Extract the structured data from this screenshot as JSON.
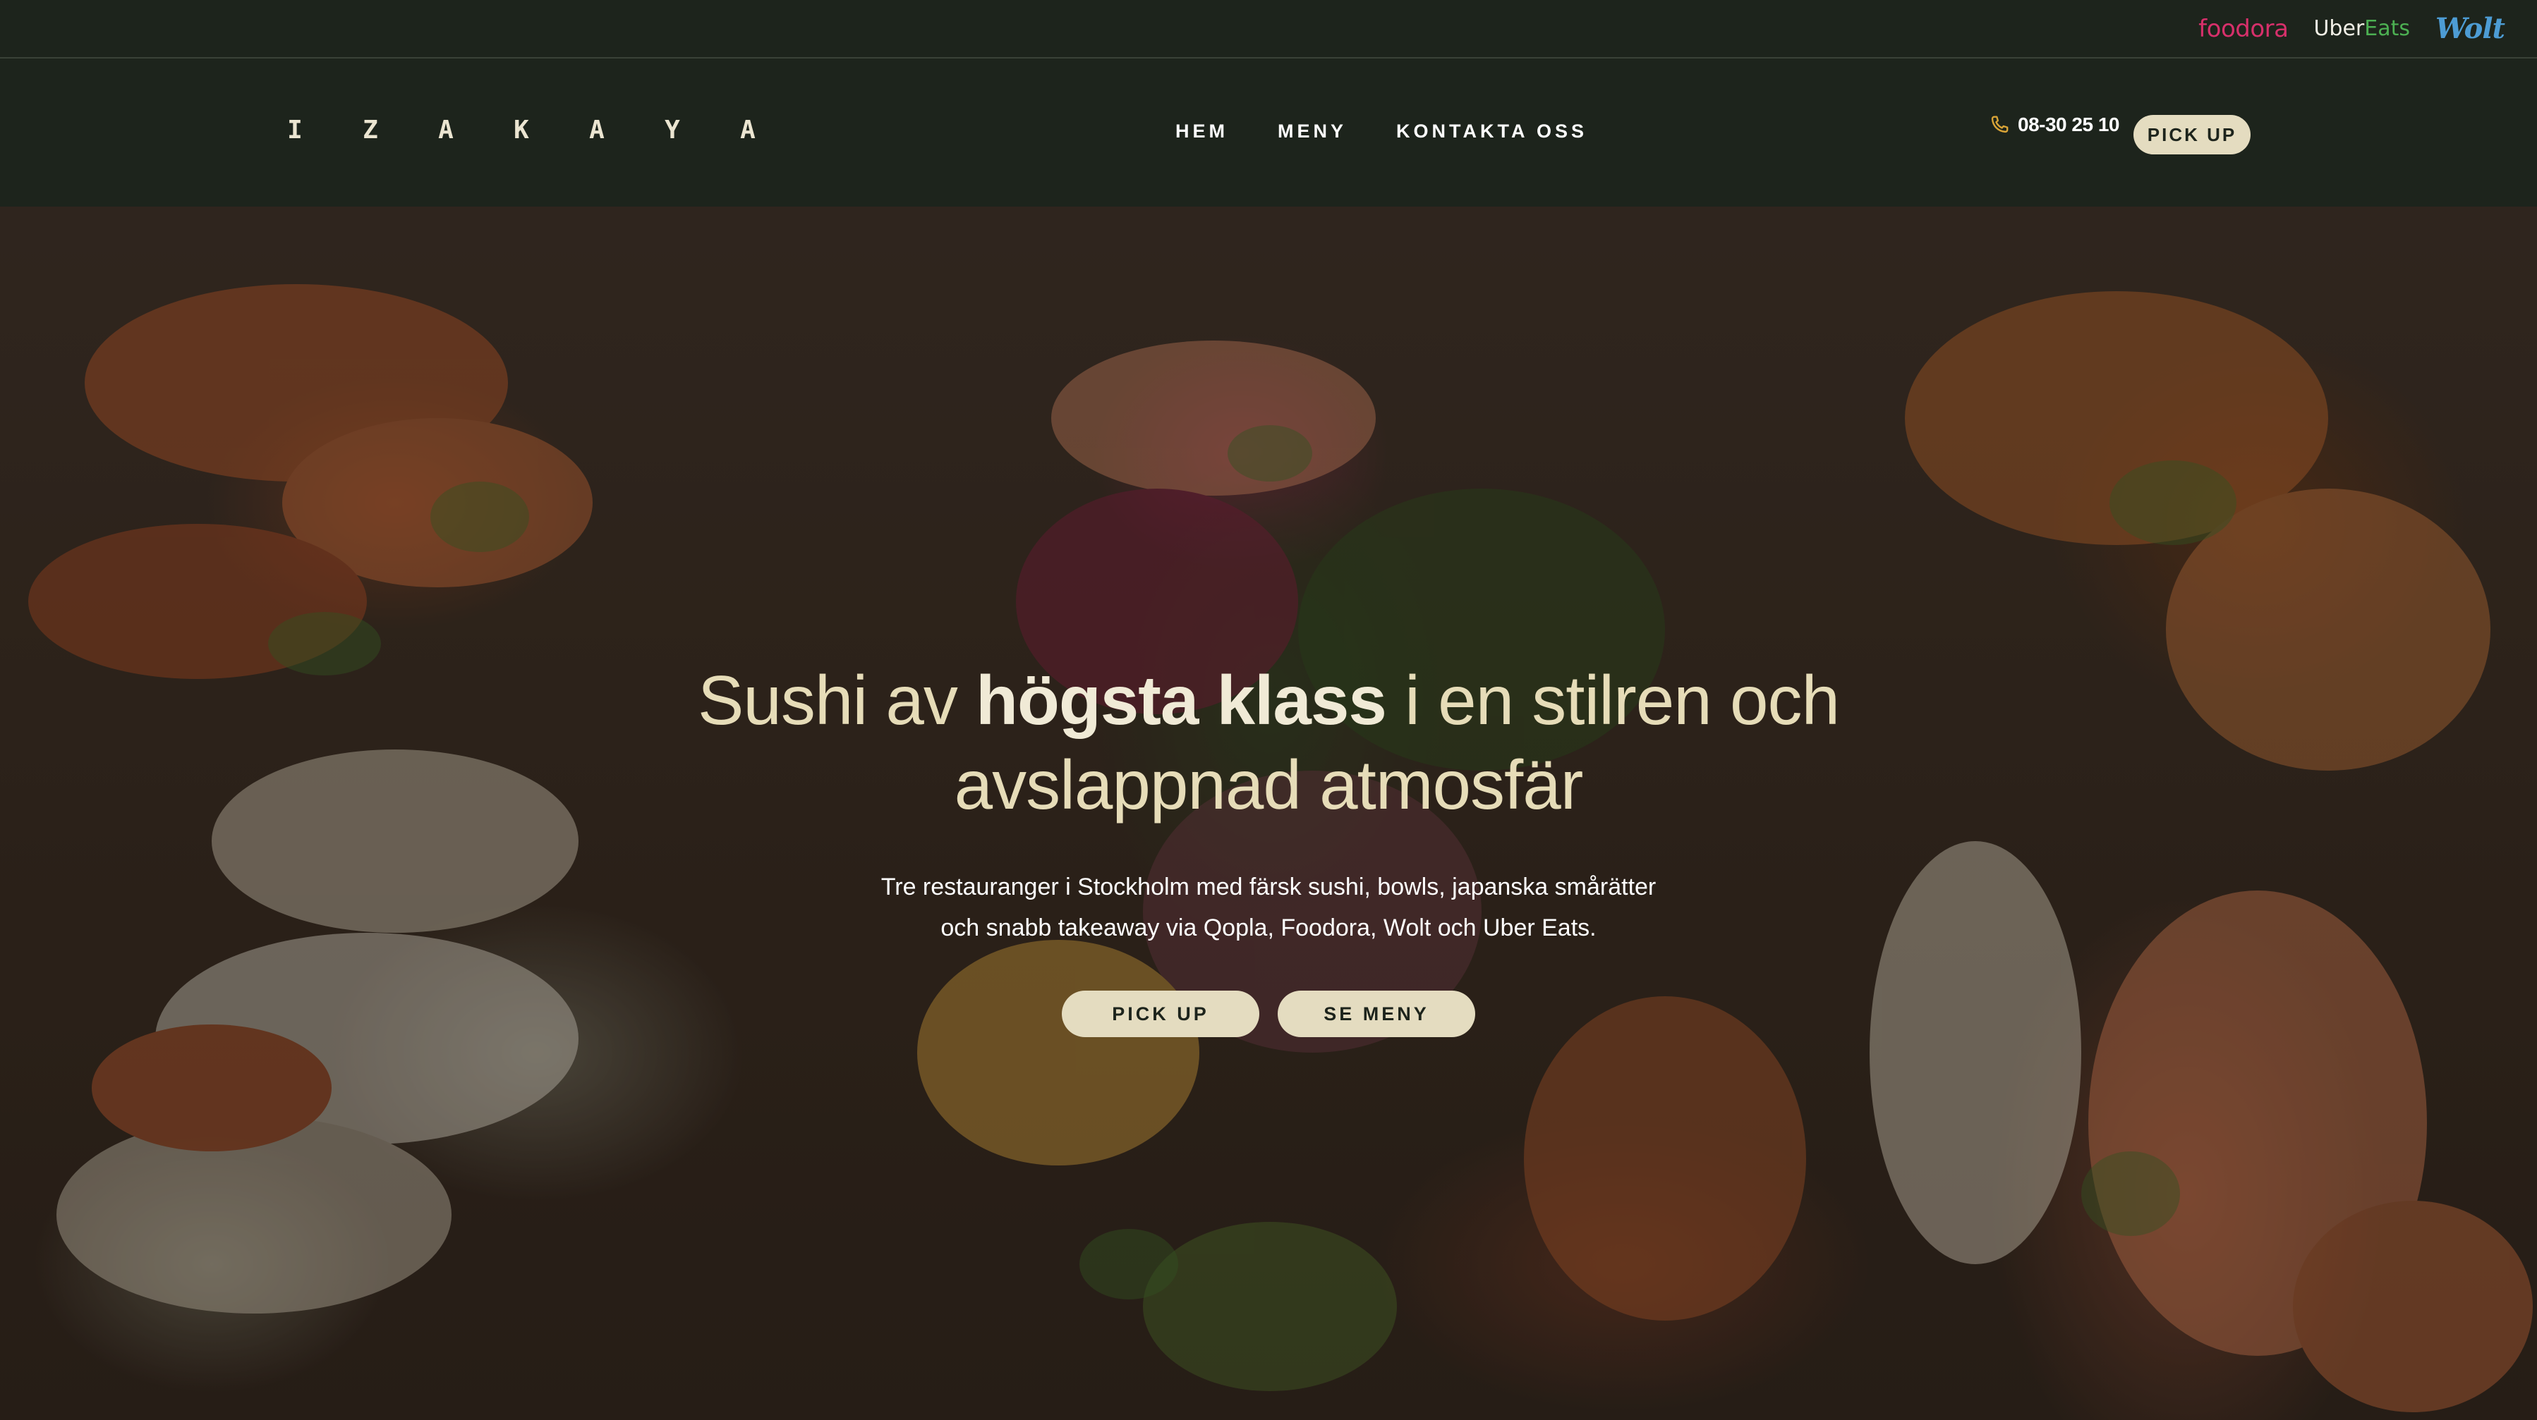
{
  "delivery_partners": {
    "foodora": "foodora",
    "uber_eats": {
      "uber": "Uber",
      "eats": "Eats"
    },
    "wolt": "Wolt"
  },
  "header": {
    "logo_letters": [
      "I",
      "Z",
      "A",
      "K",
      "A",
      "Y",
      "A"
    ],
    "nav": [
      {
        "label": "HEM"
      },
      {
        "label": "MENY"
      },
      {
        "label": "KONTAKTA OSS"
      }
    ],
    "phone": {
      "icon": "phone-icon",
      "number": "08-30 25 10"
    },
    "pickup_label": "PICK UP"
  },
  "hero": {
    "title_part1": "Sushi av ",
    "title_bold": "högsta klass",
    "title_part2": " i en stilren och avslappnad atmosfär",
    "subtitle_line1": "Tre restauranger i Stockholm med färsk sushi, bowls, japanska smårätter",
    "subtitle_line2": "och snabb takeaway via Qopla, Foodora, Wolt och Uber Eats.",
    "buttons": {
      "pickup": "PICK UP",
      "menu": "SE MENY"
    }
  },
  "colors": {
    "background": "#1d241c",
    "accent_button": "#e4dcc0",
    "phone_icon": "#d9a437",
    "foodora": "#d7306b",
    "uber_eats_green": "#4cb052",
    "wolt": "#4d9cd4"
  }
}
